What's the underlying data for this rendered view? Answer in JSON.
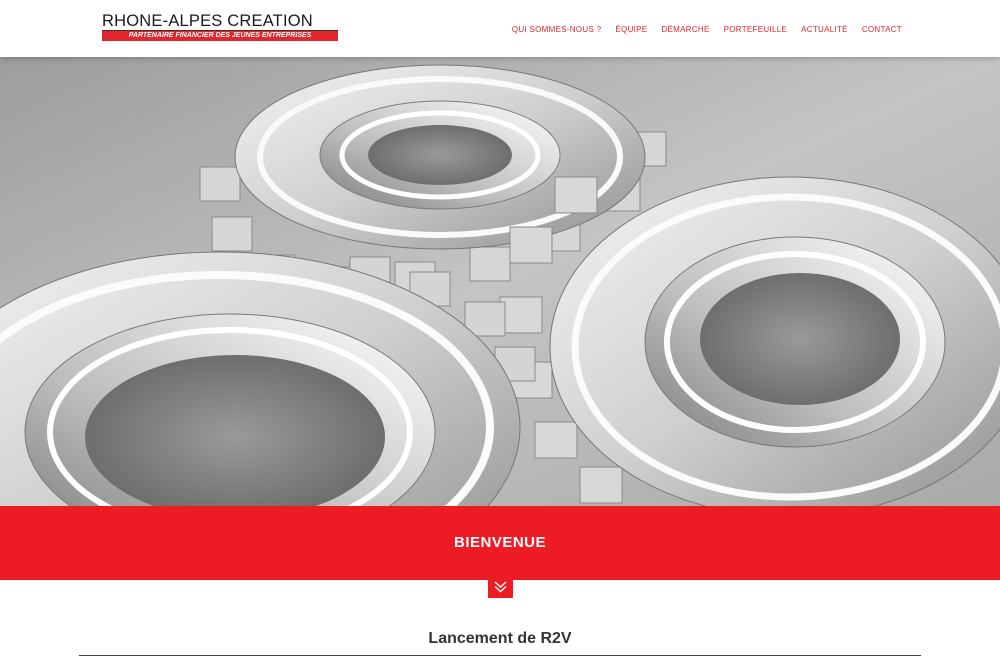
{
  "header": {
    "logo_title": "RHONE-ALPES CREATION",
    "logo_tagline": "PARTENAIRE FINANCIER DES JEUNES ENTREPRISES",
    "nav": [
      {
        "label": "QUI SOMMES-NOUS ?"
      },
      {
        "label": "ÉQUIPE"
      },
      {
        "label": "DÉMARCHE"
      },
      {
        "label": "PORTEFEUILLE"
      },
      {
        "label": "ACTUALITÉ"
      },
      {
        "label": "CONTACT"
      }
    ]
  },
  "hero": {
    "image": "three-silver-gears-photo"
  },
  "banner": {
    "title": "BIENVENUE",
    "scroll_icon": "double-chevron-down-icon"
  },
  "content": {
    "article_title": "Lancement de R2V"
  },
  "colors": {
    "brand_red": "#ED1C24",
    "nav_red": "#E3262B",
    "logo_text": "#1A1A1A"
  }
}
